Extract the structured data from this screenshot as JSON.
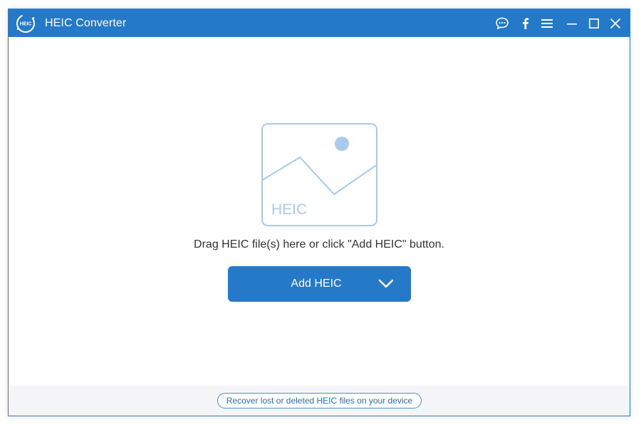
{
  "app": {
    "title": "HEIC Converter",
    "logo_text": "HEIC",
    "logo_icon": "heic-logo-icon"
  },
  "titlebar": {
    "buttons": [
      {
        "name": "feedback",
        "icon": "chat-bubble-icon"
      },
      {
        "name": "facebook",
        "icon": "facebook-icon"
      },
      {
        "name": "menu",
        "icon": "hamburger-menu-icon"
      },
      {
        "name": "minimize",
        "icon": "minimize-icon"
      },
      {
        "name": "maximize",
        "icon": "maximize-icon"
      },
      {
        "name": "close",
        "icon": "close-icon"
      }
    ]
  },
  "main": {
    "placeholder_label": "HEIC",
    "placeholder_icon": "image-placeholder-icon",
    "hint": "Drag HEIC file(s) here or click \"Add HEIC\" button.",
    "add_button": {
      "label": "Add HEIC",
      "dropdown_icon": "chevron-down-icon"
    }
  },
  "footer": {
    "recover_link": "Recover lost or deleted HEIC files on your device"
  },
  "colors": {
    "accent": "#2479c9",
    "placeholder": "#a8cbec",
    "link": "#2a6fb7",
    "footer_bg": "#f5f5f7"
  }
}
